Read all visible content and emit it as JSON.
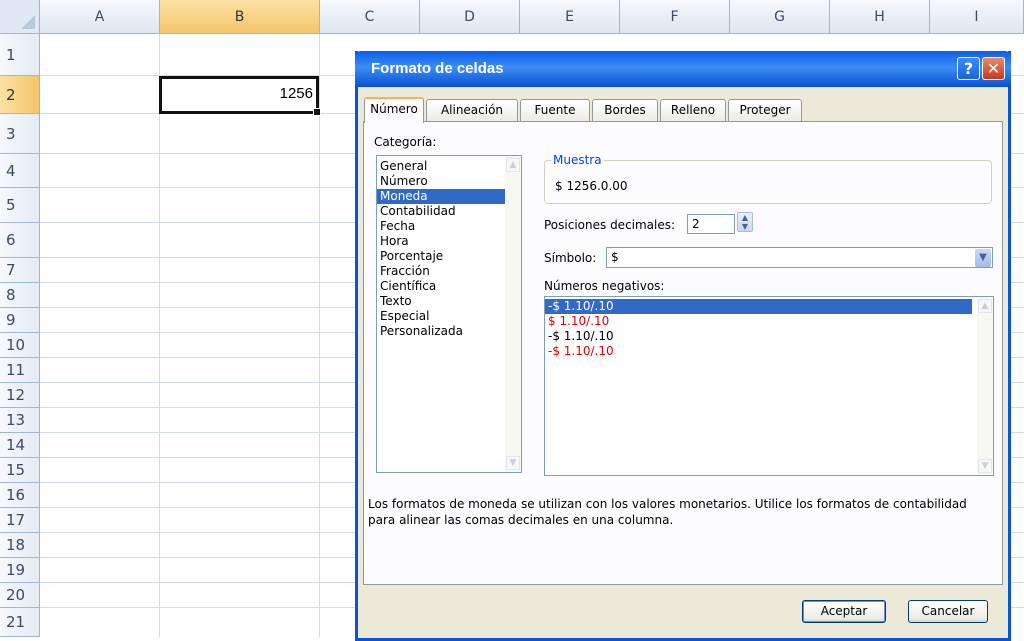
{
  "sheet": {
    "columns": [
      "A",
      "B",
      "C",
      "D",
      "E",
      "F",
      "G",
      "H",
      "I"
    ],
    "rows": [
      "1",
      "2",
      "3",
      "4",
      "5",
      "6",
      "7",
      "8",
      "9",
      "10",
      "11",
      "12",
      "13",
      "14",
      "15",
      "16",
      "17",
      "18",
      "19",
      "20",
      "21"
    ],
    "selected_column": "B",
    "selected_row": "2",
    "cell_b2_value": "1256"
  },
  "dialog": {
    "title": "Formato de celdas",
    "help_glyph": "?",
    "close_glyph": "✕",
    "tabs": [
      "Número",
      "Alineación",
      "Fuente",
      "Bordes",
      "Relleno",
      "Proteger"
    ],
    "active_tab": "Número",
    "category_label": "Categoría:",
    "categories": [
      "General",
      "Número",
      "Moneda",
      "Contabilidad",
      "Fecha",
      "Hora",
      "Porcentaje",
      "Fracción",
      "Científica",
      "Texto",
      "Especial",
      "Personalizada"
    ],
    "selected_category": "Moneda",
    "sample_label": "Muestra",
    "sample_value": "$ 1256.0.00",
    "decimals_label": "Posiciones decimales:",
    "decimals_value": "2",
    "symbol_label": "Símbolo:",
    "symbol_value": "$",
    "negatives_label": "Números negativos:",
    "negatives": [
      {
        "text": "-$ 1.10/.10",
        "red": false
      },
      {
        "text": "$ 1.10/.10",
        "red": true
      },
      {
        "text": "-$ 1.10/.10",
        "red": false
      },
      {
        "text": "-$ 1.10/.10",
        "red": true
      }
    ],
    "description": "Los formatos de moneda se utilizan con los valores monetarios. Utilice los formatos de contabilidad para alinear las comas decimales en una columna.",
    "ok_label": "Aceptar",
    "cancel_label": "Cancelar"
  },
  "colors": {
    "title_bar": "#0a5ee8",
    "selection": "#316ac5",
    "negative_red": "#e00000",
    "header_highlight": "#f5c46a"
  }
}
